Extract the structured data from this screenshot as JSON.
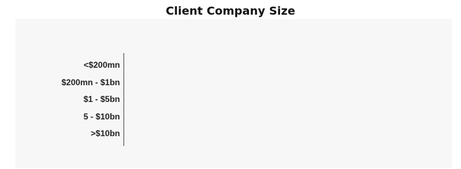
{
  "chart_data": {
    "type": "bar",
    "orientation": "horizontal",
    "title": "Client Company Size",
    "xlabel": "",
    "ylabel": "",
    "categories": [
      "<$200mn",
      "$200mn - $1bn",
      "$1 - $5bn",
      "5 - $10bn",
      ">$10bn"
    ],
    "values": [
      0,
      0,
      0,
      0,
      0
    ],
    "grid": false,
    "colors": {
      "bar": "#4a90c2",
      "background": "#f7f7f7",
      "axis": "#555555"
    }
  }
}
